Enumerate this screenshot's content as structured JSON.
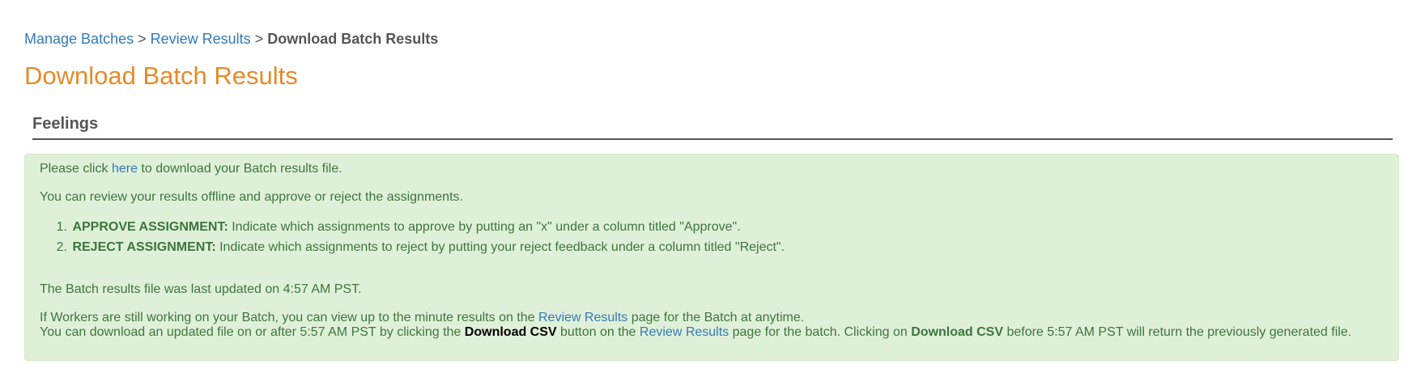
{
  "breadcrumb": {
    "manage_batches": "Manage Batches",
    "sep1": ">",
    "review_results": "Review Results",
    "sep2": ">",
    "current": "Download Batch Results"
  },
  "page_title": "Download Batch Results",
  "section": {
    "title": "Feelings"
  },
  "alert": {
    "line1_prefix": "Please click",
    "line1_link": "here",
    "line1_suffix": "to download your Batch results file.",
    "line2": "You can review your results offline and approve or reject the assignments.",
    "items": [
      {
        "number": "1.",
        "label": "APPROVE ASSIGNMENT:",
        "text": "Indicate which assignments to approve by putting an \"x\" under a column titled \"Approve\"."
      },
      {
        "number": "2.",
        "label": "REJECT ASSIGNMENT:",
        "text": "Indicate which assignments to reject by putting your reject feedback under a column titled \"Reject\"."
      }
    ],
    "updated_text": "The Batch results file was last updated on 4:57 AM PST.",
    "workers_prefix": "If Workers are still working on your Batch, you can view up to the minute results on the",
    "workers_link": "Review Results",
    "workers_suffix": "page for the Batch at anytime.",
    "download_prefix": "You can download an updated file on or after 5:57 AM PST by clicking the",
    "download_csv_1": "Download CSV",
    "download_middle": "button on the",
    "download_link": "Review Results",
    "download_middle2": "page for the batch. Clicking on",
    "download_csv_2": "Download CSV",
    "download_suffix": "before 5:57 AM PST will return the previously generated file."
  }
}
